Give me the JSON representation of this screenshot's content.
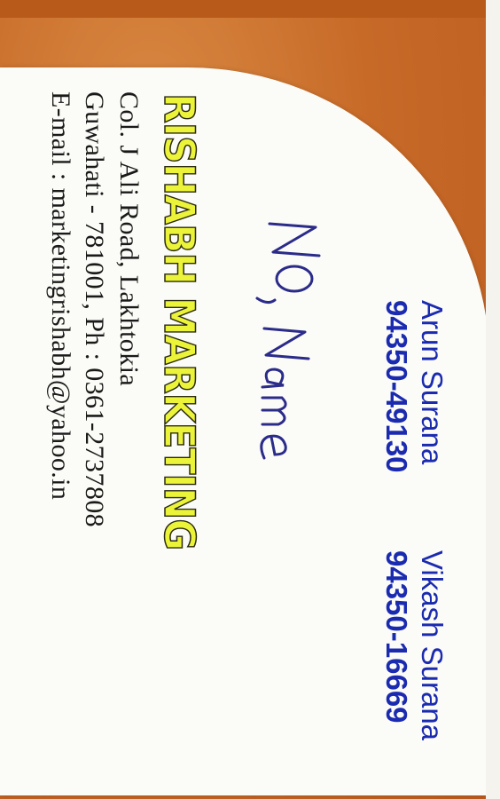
{
  "card": {
    "contacts": [
      {
        "name": "Arun Surana",
        "phone": "94350-49130"
      },
      {
        "name": "Vikash Surana",
        "phone": "94350-16669"
      }
    ],
    "company": "RISHABH MARKETING",
    "address_line1": "Col. J Ali Road, Lakhtokia",
    "address_line2": "Guwahati - 781001, Ph : 0361-2737808",
    "email_line": "E-mail : marketingrishabh@yahoo.in",
    "handwritten_note": "NO, Name"
  },
  "colors": {
    "background": "#c96f2c",
    "card": "#fbfbf7",
    "contact_text": "#1b2bb0",
    "company_fill": "#ecf43a",
    "body_text": "#1a1a1a",
    "ink": "#2b2b8a"
  }
}
